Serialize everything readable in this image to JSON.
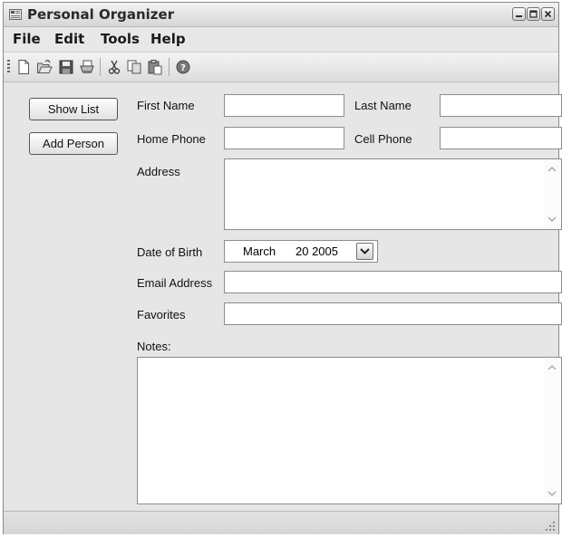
{
  "window": {
    "title": "Personal Organizer"
  },
  "menu": {
    "items": [
      "File",
      "Edit",
      "Tools",
      "Help"
    ]
  },
  "toolbar": {
    "icons": [
      "new-icon",
      "open-icon",
      "save-icon",
      "print-icon",
      "cut-icon",
      "copy-icon",
      "paste-icon",
      "help-icon"
    ]
  },
  "sidebar": {
    "show_list": "Show List",
    "add_person": "Add Person"
  },
  "form": {
    "first_name_label": "First Name",
    "last_name_label": "Last Name",
    "home_phone_label": "Home Phone",
    "cell_phone_label": "Cell Phone",
    "address_label": "Address",
    "dob_label": "Date of Birth",
    "dob_month": "March",
    "dob_daytyear": "20 2005",
    "email_label": "Email Address",
    "favorites_label": "Favorites",
    "notes_label": "Notes:",
    "first_name_value": "",
    "last_name_value": "",
    "home_phone_value": "",
    "cell_phone_value": "",
    "address_value": "",
    "email_value": "",
    "favorites_value": "",
    "notes_value": ""
  },
  "status": {
    "text": ""
  }
}
